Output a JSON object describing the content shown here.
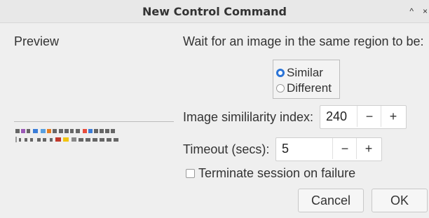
{
  "dialog": {
    "title": "New Control Command",
    "minimize_glyph": "^",
    "close_glyph": "×"
  },
  "preview": {
    "label": "Preview"
  },
  "wait": {
    "label": "Wait for an image in the same region to be:"
  },
  "mode": {
    "options": [
      "Similar",
      "Different"
    ],
    "selected": "Similar"
  },
  "similarity": {
    "label": "Image simililarity index:",
    "value": "240",
    "minus": "−",
    "plus": "+"
  },
  "timeout": {
    "label": "Timeout (secs):",
    "value": "5",
    "minus": "−",
    "plus": "+"
  },
  "terminate": {
    "label": "Terminate session on failure",
    "checked": false
  },
  "buttons": {
    "cancel": "Cancel",
    "ok": "OK"
  },
  "colors": {
    "accent": "#2b74d6",
    "dialog_bg": "#efefef"
  }
}
